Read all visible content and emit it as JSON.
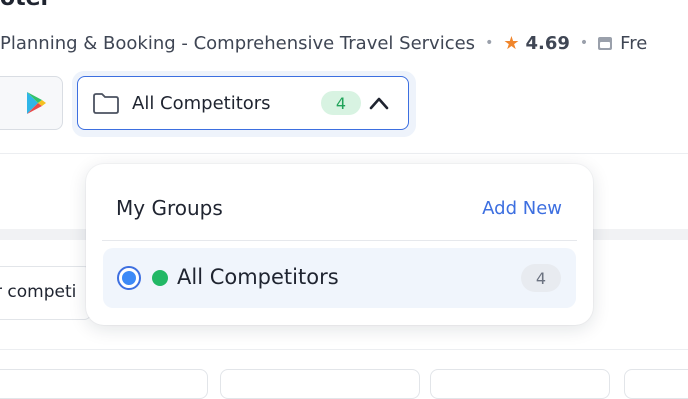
{
  "header": {
    "title_fragment": "otel",
    "subtitle": "Planning & Booking - Comprehensive Travel Services",
    "rating": "4.69",
    "pricing_fragment": "Fre"
  },
  "toolbar": {
    "platform_icon": "google-play-icon",
    "group_select": {
      "label": "All Competitors",
      "count": "4",
      "folder_icon": "folder-icon",
      "chevron_icon": "chevron-up-icon"
    }
  },
  "tabs": {
    "partial_label": "r competi"
  },
  "dropdown": {
    "heading": "My Groups",
    "add_label": "Add New",
    "items": [
      {
        "label": "All Competitors",
        "count": "4",
        "selected": true,
        "status_color": "#22b865"
      }
    ]
  },
  "colors": {
    "accent": "#3d6fe0",
    "count_pill_bg": "#d8f3e2",
    "count_pill_text": "#21a35a",
    "star": "#f0852b"
  }
}
